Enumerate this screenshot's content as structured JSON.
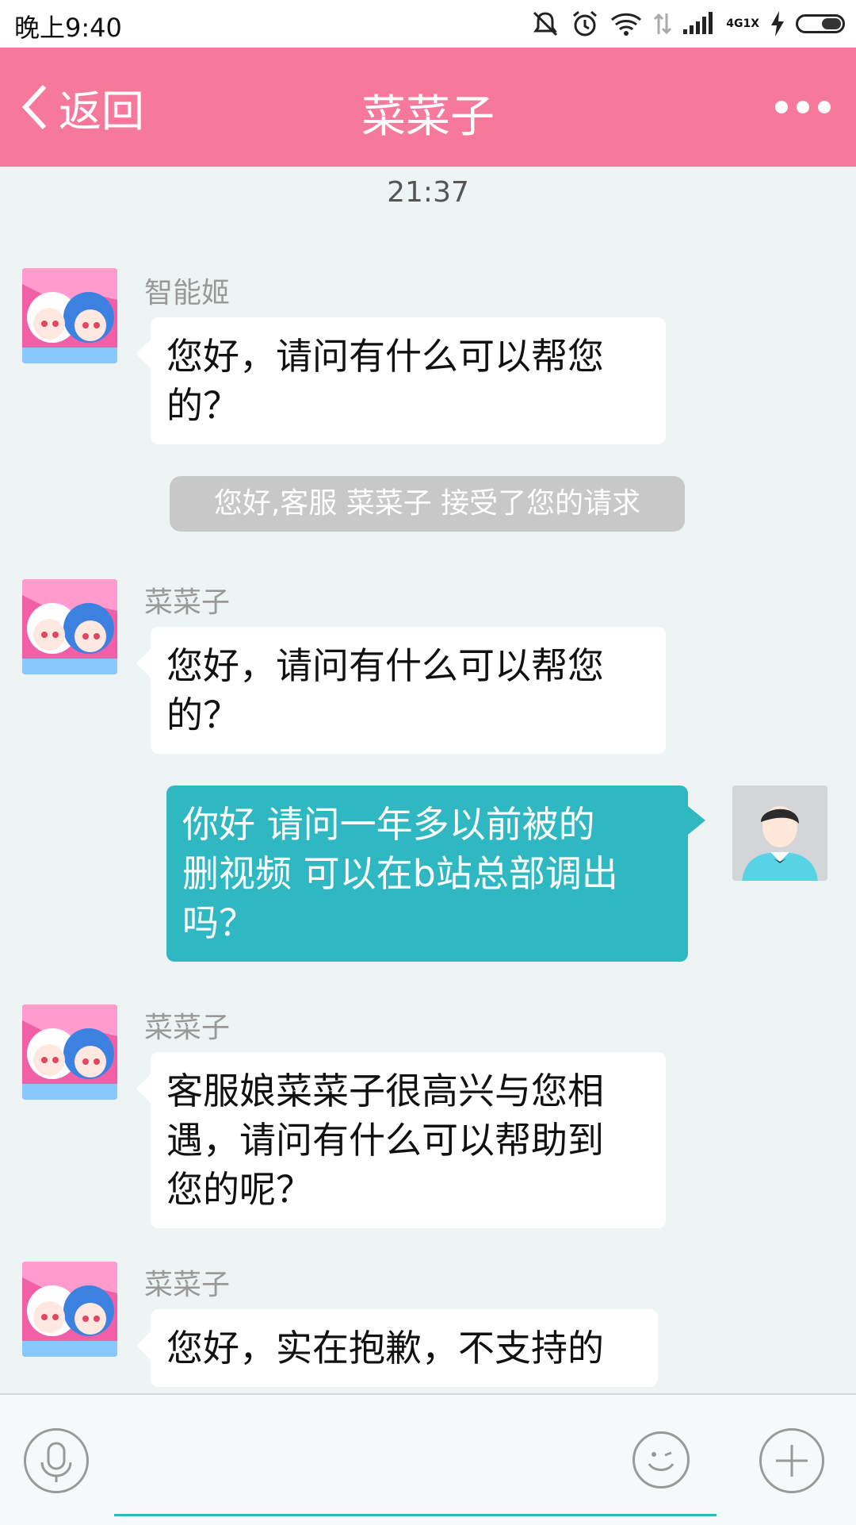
{
  "status_bar": {
    "time": "晚上9:40",
    "network_top": "4G",
    "network_bottom": "1X",
    "icons": [
      "mute-icon",
      "alarm-icon",
      "wifi-icon",
      "data-transfer-icon",
      "signal-icon",
      "charging-icon",
      "battery-icon"
    ]
  },
  "header": {
    "back_label": "返回",
    "title": "菜菜子",
    "accent_color": "#f6789b"
  },
  "chat": {
    "timestamp": "21:37",
    "messages": [
      {
        "sender": "智能姬",
        "lines": [
          "您好，请问有什么可以帮您",
          "的？"
        ]
      },
      {
        "system": "您好,客服 菜菜子 接受了您的请求"
      },
      {
        "sender": "菜菜子",
        "lines": [
          "您好，请问有什么可以帮您",
          "的？"
        ]
      },
      {
        "self": true,
        "lines": [
          "你好 请问一年多以前被的",
          "删视频 可以在b站总部调出",
          "吗？"
        ]
      },
      {
        "sender": "菜菜子",
        "lines": [
          "客服娘菜菜子很高兴与您相",
          "遇，请问有什么可以帮助到",
          "您的呢？"
        ]
      },
      {
        "sender": "菜菜子",
        "lines": [
          "您好，实在抱歉，不支持的"
        ]
      }
    ],
    "bubble_self_color": "#2fb8c2"
  },
  "input_bar": {
    "icons": [
      "microphone-icon",
      "emoji-icon",
      "plus-icon"
    ]
  }
}
